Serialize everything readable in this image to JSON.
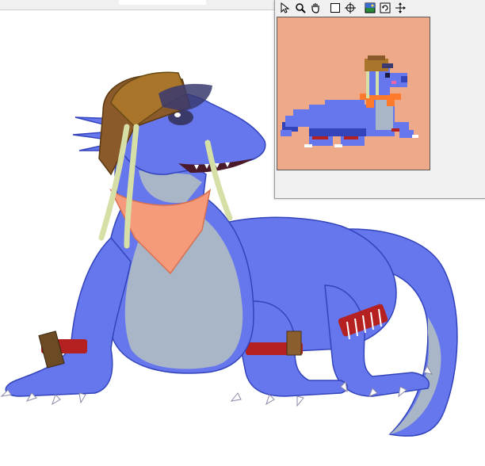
{
  "colors": {
    "sprite_bg": "#eeaa88",
    "body_blue": "#6677ee",
    "body_dark": "#3344bb",
    "belly": "#a9b6c8",
    "bandana": "#f59a7a",
    "band_red": "#b52020",
    "hat_brown": "#a8752a",
    "strap": "#d6dfa6"
  },
  "toolbar": {
    "tools": [
      {
        "id": "select",
        "icon": "arrow-cursor-icon"
      },
      {
        "id": "zoom",
        "icon": "magnifier-icon"
      },
      {
        "id": "pan",
        "icon": "hand-icon"
      },
      {
        "id": "rect",
        "icon": "rectangle-select-icon"
      },
      {
        "id": "crosshair",
        "icon": "crosshair-icon"
      },
      {
        "id": "image",
        "icon": "picture-icon"
      },
      {
        "id": "refresh",
        "icon": "refresh-icon"
      },
      {
        "id": "resize",
        "icon": "resize-arrows-icon"
      }
    ]
  }
}
